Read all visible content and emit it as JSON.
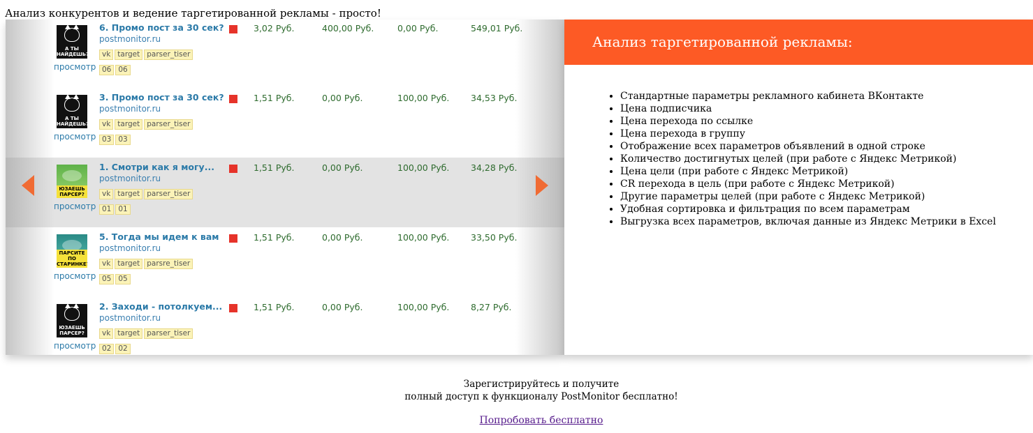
{
  "page": {
    "title": "Анализ конкурентов и ведение таргетированной рекламы - просто!"
  },
  "ads": [
    {
      "title": "6. Промо пост за 30 сек?",
      "domain": "postmonitor.ru",
      "tags": [
        "vk",
        "target",
        "parser_tiser"
      ],
      "view_label": "просмотр",
      "dates": [
        "06",
        "06"
      ],
      "thumb_caption": "А ТЫ НАЙДЕШЬ?",
      "thumb_style": "dark",
      "stats": [
        {
          "value": "3,02",
          "currency": "Руб."
        },
        {
          "value": "400,00",
          "currency": "Руб."
        },
        {
          "value": "0,00",
          "currency": "Руб."
        },
        {
          "value": "549,01",
          "currency": "Руб."
        }
      ]
    },
    {
      "title": "3. Промо пост за 30 сек?",
      "domain": "postmonitor.ru",
      "tags": [
        "vk",
        "target",
        "parser_tiser"
      ],
      "view_label": "просмотр",
      "dates": [
        "03",
        "03"
      ],
      "thumb_caption": "А ТЫ НАЙДЕШЬ?",
      "thumb_style": "dark",
      "stats": [
        {
          "value": "1,51",
          "currency": "Руб."
        },
        {
          "value": "0,00",
          "currency": "Руб."
        },
        {
          "value": "100,00",
          "currency": "Руб."
        },
        {
          "value": "34,53",
          "currency": "Руб."
        }
      ]
    },
    {
      "title": "1. Смотри как я могу...",
      "domain": "postmonitor.ru",
      "tags": [
        "vk",
        "target",
        "parser_tiser"
      ],
      "view_label": "просмотр",
      "dates": [
        "01",
        "01"
      ],
      "thumb_caption": "ЮЗАЕШЬ ПАРСЕР?",
      "thumb_style": "green",
      "stats": [
        {
          "value": "1,51",
          "currency": "Руб."
        },
        {
          "value": "0,00",
          "currency": "Руб."
        },
        {
          "value": "100,00",
          "currency": "Руб."
        },
        {
          "value": "34,28",
          "currency": "Руб."
        }
      ]
    },
    {
      "title": "5. Тогда мы идем к вам",
      "domain": "postmonitor.ru",
      "tags": [
        "vk",
        "target",
        "parsre_tiser"
      ],
      "view_label": "просмотр",
      "dates": [
        "05",
        "05"
      ],
      "thumb_caption": "ПАРСИТЕ ПО СТАРИНКЕ?",
      "thumb_style": "teal",
      "stats": [
        {
          "value": "1,51",
          "currency": "Руб."
        },
        {
          "value": "0,00",
          "currency": "Руб."
        },
        {
          "value": "100,00",
          "currency": "Руб."
        },
        {
          "value": "33,50",
          "currency": "Руб."
        }
      ]
    },
    {
      "title": "2. Заходи - потолкуем...",
      "domain": "postmonitor.ru",
      "tags": [
        "vk",
        "target",
        "parser_tiser"
      ],
      "view_label": "просмотр",
      "dates": [
        "02",
        "02"
      ],
      "thumb_caption": "ЮЗАЕШЬ ПАРСЕР?",
      "thumb_style": "dark",
      "stats": [
        {
          "value": "1,51",
          "currency": "Руб."
        },
        {
          "value": "0,00",
          "currency": "Руб."
        },
        {
          "value": "100,00",
          "currency": "Руб."
        },
        {
          "value": "8,27",
          "currency": "Руб."
        }
      ]
    }
  ],
  "info": {
    "heading": "Анализ таргетированной рекламы:",
    "features": [
      "Стандартные параметры рекламного кабинета ВКонтакте",
      "Цена подписчика",
      "Цена перехода по ссылке",
      "Цена перехода в группу",
      "Отображение всех параметров объявлений в одной строке",
      "Количество достигнутых целей (при работе с Яндекс Метрикой)",
      "Цена цели (при работе с Яндекс Метрикой)",
      "CR перехода в цель (при работе с Яндекс Метрикой)",
      "Другие параметры целей (при работе с Яндекс Метрикой)",
      "Удобная сортировка и фильтрация по всем параметрам",
      "Выгрузка всех параметров, включая данные из Яндекс Метрики в Excel"
    ]
  },
  "cta": {
    "line1": "Зарегистрируйтесь и получите",
    "line2": "полный доступ к функционалу PostMonitor бесплатно!",
    "link": "Попробовать бесплатно"
  },
  "icons": {
    "prev": "chevron-left-icon",
    "next": "chevron-right-icon",
    "status": "status-square-icon"
  },
  "colors": {
    "accent": "#fd5a25",
    "arrow": "#f06b33",
    "status": "#e6332a",
    "link": "#2b7aa8",
    "stat": "#2e6b2e"
  },
  "slider": {
    "highlighted_index": 2
  }
}
